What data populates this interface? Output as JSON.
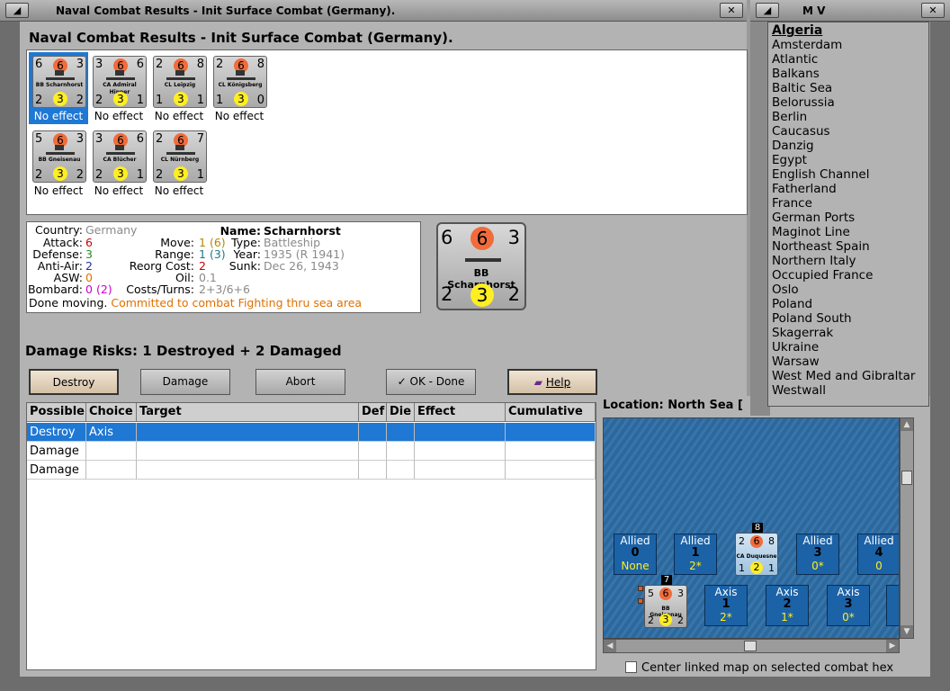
{
  "main_window": {
    "title": "Naval Combat Results - Init Surface Combat (Germany).",
    "heading": "Naval Combat Results - Init Surface Combat (Germany)."
  },
  "results": [
    {
      "name": "BB Scharnhorst",
      "tl": "6",
      "orb": "6",
      "tr": "3",
      "bl": "2",
      "yel": "3",
      "br": "2",
      "effect": "No effect"
    },
    {
      "name": "CA Admiral Hipper",
      "tl": "3",
      "orb": "6",
      "tr": "6",
      "bl": "2",
      "yel": "3",
      "br": "1",
      "effect": "No effect"
    },
    {
      "name": "CL Leipzig",
      "tl": "2",
      "orb": "6",
      "tr": "8",
      "bl": "1",
      "yel": "3",
      "br": "1",
      "effect": "No effect"
    },
    {
      "name": "CL Königsberg",
      "tl": "2",
      "orb": "6",
      "tr": "8",
      "bl": "1",
      "yel": "3",
      "br": "0",
      "effect": "No effect"
    },
    {
      "name": "BB Gneisenau",
      "tl": "5",
      "orb": "6",
      "tr": "3",
      "bl": "2",
      "yel": "3",
      "br": "2",
      "effect": "No effect"
    },
    {
      "name": "CA Blücher",
      "tl": "3",
      "orb": "6",
      "tr": "6",
      "bl": "2",
      "yel": "3",
      "br": "1",
      "effect": "No effect"
    },
    {
      "name": "CL Nürnberg",
      "tl": "2",
      "orb": "6",
      "tr": "7",
      "bl": "2",
      "yel": "3",
      "br": "1",
      "effect": "No effect"
    }
  ],
  "info": {
    "country_label": "Country:",
    "country": "Germany",
    "attack_label": "Attack:",
    "attack": "6",
    "defense_label": "Defense:",
    "defense": "3",
    "antiair_label": "Anti-Air:",
    "antiair": "2",
    "asw_label": "ASW:",
    "asw": "0",
    "bombard_label": "Bombard:",
    "bombard": "0",
    "bombard_extra": "(2)",
    "move_label": "Move:",
    "move": "1",
    "move_extra": "(6)",
    "range_label": "Range:",
    "range": "1",
    "range_extra": "(3)",
    "reorg_label": "Reorg Cost:",
    "reorg": "2",
    "oil_label": "Oil:",
    "oil": "0.1",
    "costs_label": "Costs/Turns:",
    "costs": "2+3/6+6",
    "name_label": "Name:",
    "name": "Scharnhorst",
    "type_label": "Type:",
    "type": "Battleship",
    "year_label": "Year:",
    "year": "1935 (R 1941)",
    "sunk_label": "Sunk:",
    "sunk": "Dec 26, 1943",
    "status": "Done moving.",
    "status_detail": "Committed to combat Fighting thru sea area"
  },
  "big_counter": {
    "tl": "6",
    "orb": "6",
    "tr": "3",
    "name": "BB Scharnhorst",
    "bl": "2",
    "yel": "3",
    "br": "2"
  },
  "damage_risks": "Damage Risks:  1 Destroyed + 2 Damaged",
  "buttons": {
    "destroy": "Destroy",
    "damage": "Damage",
    "abort": "Abort",
    "ok": "OK - Done",
    "help": "Help"
  },
  "table": {
    "headers": [
      "Possible",
      "Choice",
      "Target",
      "Def",
      "Die",
      "Effect",
      "Cumulative"
    ],
    "rows": [
      {
        "possible": "Destroy",
        "choice": "Axis"
      },
      {
        "possible": "Damage",
        "choice": ""
      },
      {
        "possible": "Damage",
        "choice": ""
      }
    ]
  },
  "location_label": "Location:  North Sea [",
  "map": {
    "allied": [
      {
        "side": "Allied",
        "num": "0",
        "sub": "None"
      },
      {
        "side": "Allied",
        "num": "1",
        "sub": "2*"
      },
      {
        "side": "Allied",
        "num": "3",
        "sub": "0*"
      },
      {
        "side": "Allied",
        "num": "4",
        "sub": "0"
      }
    ],
    "axis": [
      {
        "side": "Axis",
        "num": "1",
        "sub": "2*"
      },
      {
        "side": "Axis",
        "num": "2",
        "sub": "1*"
      },
      {
        "side": "Axis",
        "num": "3",
        "sub": "0*"
      }
    ],
    "allied_counter": {
      "name": "CA Duquesne",
      "tl": "2",
      "orb": "6",
      "tr": "8",
      "bl": "1",
      "yel": "2",
      "br": "1",
      "stack": "8"
    },
    "axis_counter": {
      "name": "BB Gneisenau",
      "tl": "5",
      "orb": "6",
      "tr": "3",
      "bl": "2",
      "yel": "3",
      "br": "2",
      "stack": "7"
    }
  },
  "center_checkbox_label": "Center linked map on selected combat hex",
  "mv_window": {
    "title": "M V",
    "items": [
      "Algeria",
      "Amsterdam",
      "Atlantic",
      "Balkans",
      "Baltic Sea",
      "Belorussia",
      "Berlin",
      "Caucasus",
      "Danzig",
      "Egypt",
      "English Channel",
      "Fatherland",
      "France",
      "German Ports",
      "Maginot Line",
      "Northeast Spain",
      "Northern Italy",
      "Occupied France",
      "Oslo",
      "Poland",
      "Poland South",
      "Skagerrak",
      "Ukraine",
      "Warsaw",
      "West Med and Gibraltar",
      "Westwall"
    ]
  },
  "colors": {
    "selection": "#1e78d4",
    "attack": "#cc0000",
    "defense": "#2a8a2a",
    "gray_text": "#8a8a8a",
    "orange": "#e07000",
    "magenta": "#cc00cc"
  }
}
